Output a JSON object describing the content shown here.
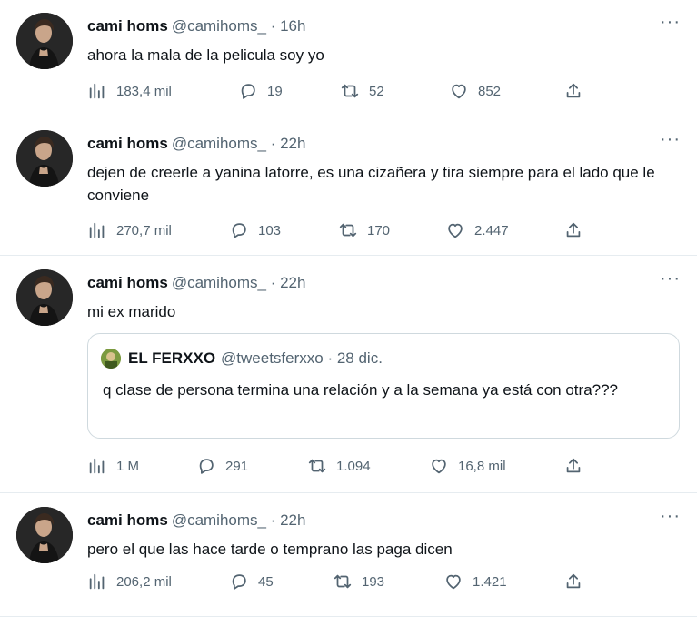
{
  "tweets": [
    {
      "name": "cami homs",
      "meta": "@camihoms_ · 16h",
      "text": "ahora la mala de la pelicula soy yo",
      "stats": {
        "views": "183,4 mil",
        "replies": "19",
        "retweets": "52",
        "likes": "852"
      }
    },
    {
      "name": "cami homs",
      "meta": "@camihoms_ · 22h",
      "text": "dejen de creerle a yanina latorre, es una cizañera y tira siempre para el lado que le conviene",
      "stats": {
        "views": "270,7 mil",
        "replies": "103",
        "retweets": "170",
        "likes": "2.447"
      }
    },
    {
      "name": "cami homs",
      "meta": "@camihoms_ · 22h",
      "text": "mi ex marido",
      "quote": {
        "name": "EL FERXXO",
        "meta": "@tweetsferxxo · 28 dic.",
        "text": "q clase de persona termina una relación y a la semana ya está con otra???"
      },
      "stats": {
        "views": "1 M",
        "replies": "291",
        "retweets": "1.094",
        "likes": "16,8 mil"
      }
    },
    {
      "name": "cami homs",
      "meta": "@camihoms_ · 22h",
      "text": "pero el que las hace tarde o temprano las paga dicen",
      "stats": {
        "views": "206,2 mil",
        "replies": "45",
        "retweets": "193",
        "likes": "1.421"
      }
    }
  ],
  "ui": {
    "more_glyph": "···",
    "accent_icon_color": "#536471",
    "border_color": "#e6ecf0"
  }
}
